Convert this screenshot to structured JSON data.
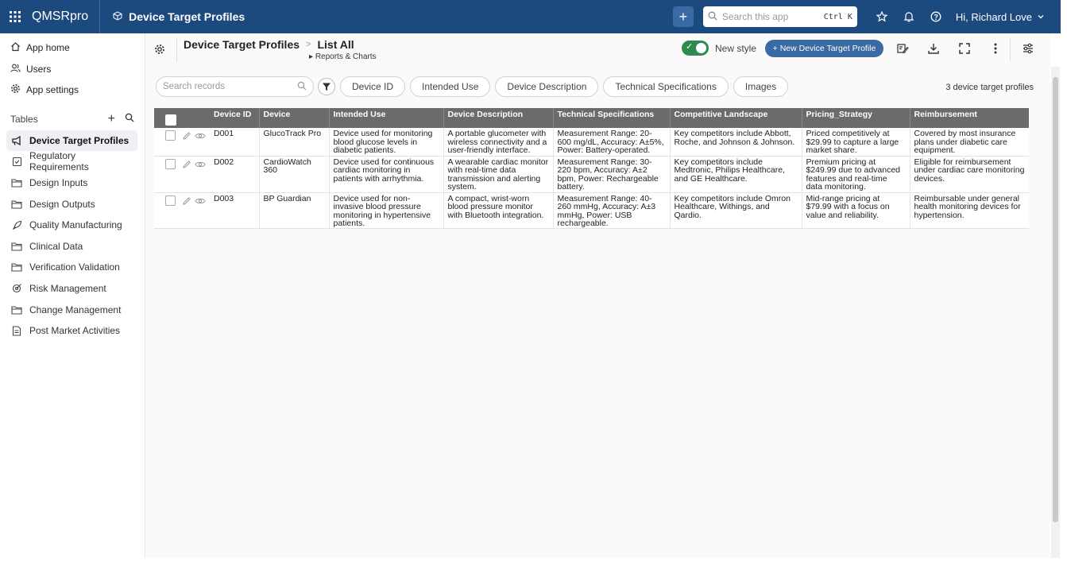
{
  "topbar": {
    "brand": "QMSRpro",
    "app_title": "Device Target Profiles",
    "search_placeholder": "Search this app",
    "search_shortcut": "Ctrl K",
    "user_greeting": "Hi, Richard Love",
    "bg_color": "#1c4a7e"
  },
  "sidebar": {
    "nav": [
      {
        "label": "App home",
        "icon": "home-icon"
      },
      {
        "label": "Users",
        "icon": "users-icon"
      },
      {
        "label": "App settings",
        "icon": "gear-icon"
      }
    ],
    "tables_header": "Tables",
    "tables": [
      {
        "label": "Device Target Profiles",
        "icon": "megaphone-icon",
        "active": true
      },
      {
        "label": "Regulatory Requirements",
        "icon": "checkbox-icon"
      },
      {
        "label": "Design Inputs",
        "icon": "folder-icon"
      },
      {
        "label": "Design Outputs",
        "icon": "folder-icon"
      },
      {
        "label": "Quality Manufacturing",
        "icon": "rocket-icon"
      },
      {
        "label": "Clinical Data",
        "icon": "folder-icon"
      },
      {
        "label": "Verification Validation",
        "icon": "folder-icon"
      },
      {
        "label": "Risk Management",
        "icon": "target-icon"
      },
      {
        "label": "Change Management",
        "icon": "folder-icon"
      },
      {
        "label": "Post Market Activities",
        "icon": "document-icon"
      }
    ]
  },
  "header": {
    "breadcrumb_table": "Device Target Profiles",
    "breadcrumb_sep": ">",
    "breadcrumb_report": "List All",
    "reports_link": "Reports & Charts",
    "toggle_label": "New style",
    "new_button": "+ New Device Target Profile"
  },
  "filters": {
    "search_placeholder": "Search records",
    "chips": [
      "Device ID",
      "Intended Use",
      "Device Description",
      "Technical Specifications",
      "Images"
    ],
    "count": "3 device target profiles"
  },
  "table": {
    "columns": [
      "Device ID",
      "Device",
      "Intended Use",
      "Device Description",
      "Technical Specifications",
      "Competitive Landscape",
      "Pricing_Strategy",
      "Reimbursement"
    ],
    "rows": [
      [
        "D001",
        "GlucoTrack Pro",
        "Device used for monitoring blood glucose levels in diabetic patients.",
        "A portable glucometer with wireless connectivity and a user-friendly interface.",
        "Measurement Range: 20-600 mg/dL, Accuracy: A±5%, Power: Battery-operated.",
        "Key competitors include Abbott, Roche, and Johnson & Johnson.",
        "Priced competitively at $29.99 to capture a large market share.",
        "Covered by most insurance plans under diabetic care equipment."
      ],
      [
        "D002",
        "CardioWatch 360",
        "Device used for continuous cardiac monitoring in patients with arrhythmia.",
        "A wearable cardiac monitor with real-time data transmission and alerting system.",
        "Measurement Range: 30-220 bpm, Accuracy: A±2 bpm, Power: Rechargeable battery.",
        "Key competitors include Medtronic, Philips Healthcare, and GE Healthcare.",
        "Premium pricing at $249.99 due to advanced features and real-time data monitoring.",
        "Eligible for reimbursement under cardiac care monitoring devices."
      ],
      [
        "D003",
        "BP Guardian",
        "Device used for non-invasive blood pressure monitoring in hypertensive patients.",
        "A compact, wrist-worn blood pressure monitor with Bluetooth integration.",
        "Measurement Range: 40-260 mmHg, Accuracy: A±3 mmHg, Power: USB rechargeable.",
        "Key competitors include Omron Healthcare, Withings, and Qardio.",
        "Mid-range pricing at $79.99 with a focus on value and reliability.",
        "Reimbursable under general health monitoring devices for hypertension."
      ]
    ]
  }
}
